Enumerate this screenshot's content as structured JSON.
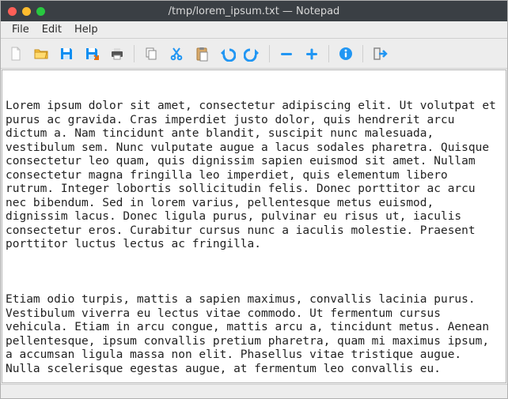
{
  "window": {
    "title": "/tmp/lorem_ipsum.txt — Notepad"
  },
  "menu": {
    "file": "File",
    "edit": "Edit",
    "help": "Help"
  },
  "toolbar": {
    "new": "new-file-icon",
    "open": "open-folder-icon",
    "save": "save-icon",
    "save_as": "save-as-icon",
    "print": "print-icon",
    "copy": "copy-icon",
    "cut": "cut-icon",
    "paste": "paste-icon",
    "undo": "undo-icon",
    "redo": "redo-icon",
    "zoom_out": "zoom-out-icon",
    "zoom_in": "zoom-in-icon",
    "info": "info-icon",
    "exit": "exit-icon"
  },
  "editor": {
    "paragraphs": [
      "Lorem ipsum dolor sit amet, consectetur adipiscing elit. Ut volutpat et purus ac gravida. Cras imperdiet justo dolor, quis hendrerit arcu dictum a. Nam tincidunt ante blandit, suscipit nunc malesuada, vestibulum sem. Nunc vulputate augue a lacus sodales pharetra. Quisque consectetur leo quam, quis dignissim sapien euismod sit amet. Nullam consectetur magna fringilla leo imperdiet, quis elementum libero rutrum. Integer lobortis sollicitudin felis. Donec porttitor ac arcu nec bibendum. Sed in lorem varius, pellentesque metus euismod, dignissim lacus. Donec ligula purus, pulvinar eu risus ut, iaculis consectetur eros. Curabitur cursus nunc a iaculis molestie. Praesent porttitor luctus lectus ac fringilla.",
      "Etiam odio turpis, mattis a sapien maximus, convallis lacinia purus. Vestibulum viverra eu lectus vitae commodo. Ut fermentum cursus vehicula. Etiam in arcu congue, mattis arcu a, tincidunt metus. Aenean pellentesque, ipsum convallis pretium pharetra, quam mi maximus ipsum, a accumsan ligula massa non elit. Phasellus vitae tristique augue. Nulla scelerisque egestas augue, at fermentum leo convallis eu."
    ]
  },
  "colors": {
    "titlebar_bg": "#3a3f44",
    "accent_blue": "#2196f3",
    "folder_yellow": "#f9c23c",
    "save_blue": "#0d8ef1"
  }
}
